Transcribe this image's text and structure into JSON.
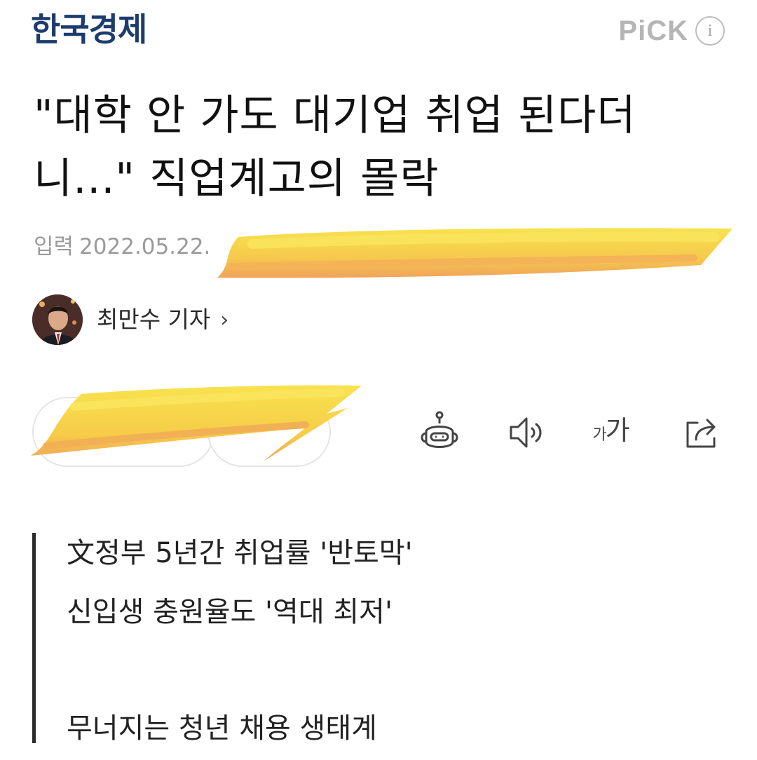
{
  "header": {
    "masthead": "한국경제",
    "pick_label": "PiCK",
    "info_icon": "info-icon"
  },
  "article": {
    "headline": "\"대학 안 가도 대기업 취업 된다더니...\" 직업계고의 몰락",
    "date_label": "입력",
    "date_value": "2022.05.22.",
    "author_name": "최만수 기자",
    "author_chevron": "›"
  },
  "toolbar": {
    "icons": [
      "robot-icon",
      "speaker-icon",
      "font-size-icon",
      "share-icon"
    ],
    "font_small": "가",
    "font_large": "가"
  },
  "summary": {
    "line1": "文정부 5년간 취업률 '반토막'",
    "line2": "신입생 충원율도 '역대 최저'",
    "line3": "무너지는 청년 채용 생태계"
  },
  "colors": {
    "masthead": "#1d3c6e",
    "scribble": "#f7d84a",
    "scribble_edge": "#f2a65a"
  }
}
